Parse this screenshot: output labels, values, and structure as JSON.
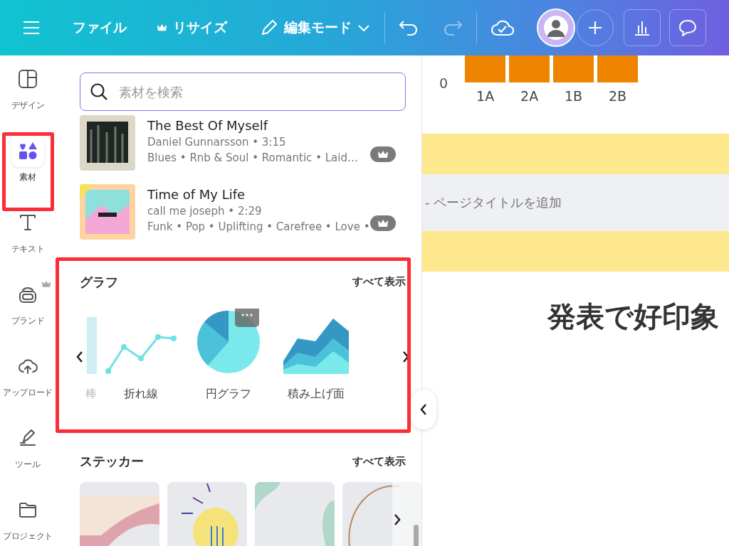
{
  "toolbar": {
    "file": "ファイル",
    "resize": "リサイズ",
    "edit_mode": "編集モード",
    "undo_disabled": false,
    "redo_disabled": true
  },
  "sidebar": {
    "items": [
      {
        "kind": "design",
        "label": "デザイン",
        "selected": false,
        "premium": false
      },
      {
        "kind": "elements",
        "label": "素材",
        "selected": true,
        "premium": false
      },
      {
        "kind": "text",
        "label": "テキスト",
        "selected": false,
        "premium": false
      },
      {
        "kind": "brand",
        "label": "ブランド",
        "selected": false,
        "premium": true
      },
      {
        "kind": "upload",
        "label": "アップロード",
        "selected": false,
        "premium": false
      },
      {
        "kind": "tools",
        "label": "ツール",
        "selected": false,
        "premium": false
      },
      {
        "kind": "projects",
        "label": "プロジェクト",
        "selected": false,
        "premium": false
      }
    ]
  },
  "search": {
    "placeholder": "素材を検索"
  },
  "tracks": [
    {
      "title": "The Best Of Myself",
      "meta": "Daniel Gunnarsson • 3:15",
      "tags": "Blues • Rnb & Soul • Romantic • Laid…",
      "premium": true
    },
    {
      "title": "Time of My Life",
      "meta": "call me joseph • 2:29",
      "tags": "Funk • Pop • Uplifting • Carefree • Love •",
      "premium": true
    }
  ],
  "charts_section": {
    "title": "グラフ",
    "see_all": "すべて表示",
    "items": [
      {
        "kind": "bar",
        "label": "棒",
        "partial": true
      },
      {
        "kind": "line",
        "label": "折れ線",
        "partial": false
      },
      {
        "kind": "pie",
        "label": "円グラフ",
        "partial": false
      },
      {
        "kind": "area",
        "label": "積み上げ面",
        "partial": false
      }
    ]
  },
  "stickers_section": {
    "title": "ステッカー",
    "see_all": "すべて表示"
  },
  "canvas": {
    "chart": {
      "y_tick": "0",
      "categories": [
        "1A",
        "2A",
        "1B",
        "2B"
      ]
    },
    "page_title_placeholder": "- ページタイトルを追加",
    "heading": "発表で好印象"
  }
}
